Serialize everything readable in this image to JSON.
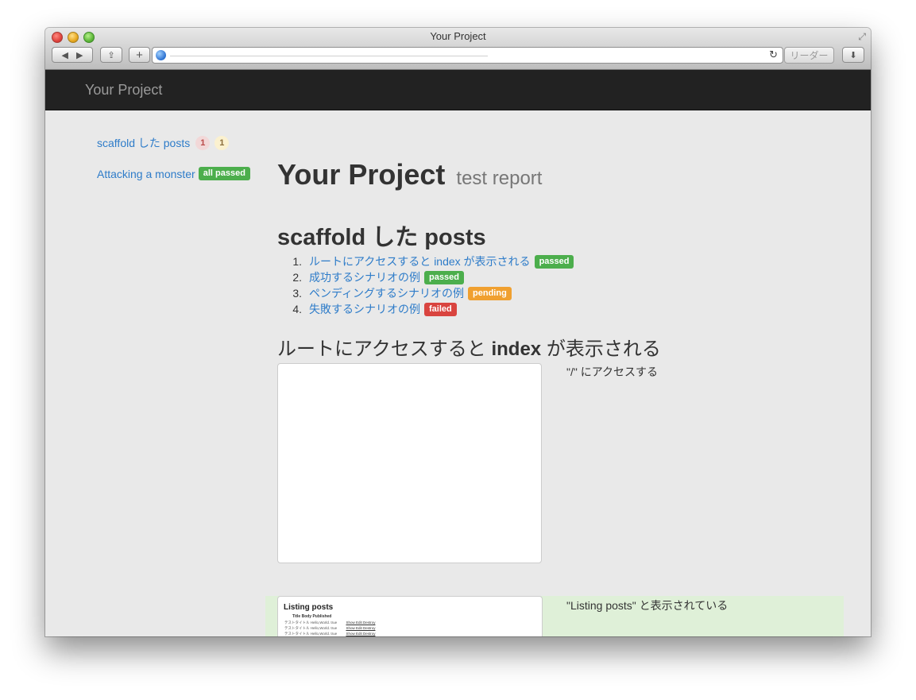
{
  "window": {
    "title": "Your Project",
    "reader_label": "リーダー"
  },
  "navbar": {
    "brand": "Your Project"
  },
  "sidebar": {
    "features": [
      {
        "label": "scaffold した posts",
        "failed_count": "1",
        "pending_count": "1"
      },
      {
        "label": "Attacking a monster",
        "status": "all passed"
      }
    ]
  },
  "page": {
    "title": "Your Project",
    "subtitle": "test report"
  },
  "feature": {
    "title": "scaffold した posts",
    "scenarios": [
      {
        "num": "1.",
        "label": "ルートにアクセスすると index が表示される",
        "status": "passed"
      },
      {
        "num": "2.",
        "label": "成功するシナリオの例",
        "status": "passed"
      },
      {
        "num": "3.",
        "label": "ペンディングするシナリオの例",
        "status": "pending"
      },
      {
        "num": "4.",
        "label": "失敗するシナリオの例",
        "status": "failed"
      }
    ]
  },
  "scenario_detail": {
    "heading_pre": "ルートにアクセスすると ",
    "heading_bold": "index",
    "heading_post": " が表示される",
    "steps": [
      {
        "text": "\"/\" にアクセスする"
      },
      {
        "text": "\"Listing posts\" と表示されている"
      }
    ],
    "screenshot_listing": {
      "title": "Listing posts",
      "headers": "Title        Body     Published",
      "rows": [
        {
          "text": "テストタイトル Hello,World. true",
          "actions": "Show Edit Destroy"
        },
        {
          "text": "テストタイトル Hello,World. true",
          "actions": "Show Edit Destroy"
        },
        {
          "text": "テストタイトル Hello,World. true",
          "actions": "Show Edit Destroy"
        }
      ]
    }
  },
  "colors": {
    "link": "#2e7cc9",
    "passed": "#4cae4c",
    "pending": "#f0a030",
    "failed": "#d9443f",
    "navbar": "#222222",
    "step_passed_bg": "#dff0d8"
  }
}
